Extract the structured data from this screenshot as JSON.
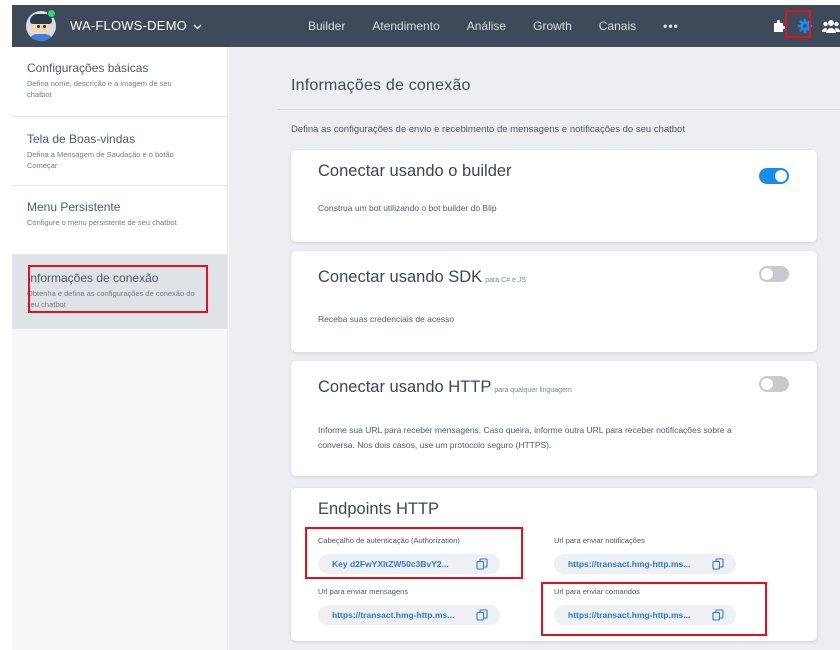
{
  "topbar": {
    "bot_name": "WA-FLOWS-DEMO",
    "nav": [
      "Builder",
      "Atendimento",
      "Análise",
      "Growth",
      "Canais",
      "•••"
    ]
  },
  "sidebar": {
    "items": [
      {
        "title": "Configurações básicas",
        "desc": "Defina nome, descrição e a imagem de seu chatbot"
      },
      {
        "title": "Tela de Boas-vindas",
        "desc": "Defina a Mensagem de Saudação e o botão Começar"
      },
      {
        "title": "Menu Persistente",
        "desc": "Configure o menu persistente de seu chatbot"
      },
      {
        "title": "Informações de conexão",
        "desc": "Obtenha e defina as configurações de conexão do seu chatbot"
      }
    ]
  },
  "main": {
    "title": "Informações de conexão",
    "description": "Defina as configurações de envio e recebimento de mensagens e notificações do seu chatbot",
    "cards": [
      {
        "title": "Conectar usando o builder",
        "subtitle": "",
        "desc": "Construa um bot utilizando o bot builder do Blip",
        "enabled": true
      },
      {
        "title": "Conectar usando SDK",
        "subtitle": "para C# e JS",
        "desc": "Receba suas credenciais de acesso",
        "enabled": false
      },
      {
        "title": "Conectar usando HTTP",
        "subtitle": "para qualquer linguagem",
        "desc": "Informe sua URL para receber mensagens. Caso queira, informe outra URL para receber notificações sobre a conversa. Nos dois casos, use um protocolo seguro (HTTPS).",
        "enabled": false
      }
    ],
    "endpoints": {
      "title": "Endpoints HTTP",
      "auth_label": "Cabeçalho de autenticação (Authorization)",
      "auth_value": "Key d2FwYXItZW50c3BvY2...",
      "notif_label": "Url para enviar notificações",
      "notif_value": "https://transact.hmg-http.ms...",
      "msg_label": "Url para enviar mensagens",
      "msg_value": "https://transact.hmg-http.ms...",
      "cmd_label": "Url para enviar comandos",
      "cmd_value": "https://transact.hmg-http.ms..."
    }
  },
  "colors": {
    "topbar": "#3e4a59",
    "accent": "#1a8cf0",
    "highlight": "#e0111b"
  }
}
